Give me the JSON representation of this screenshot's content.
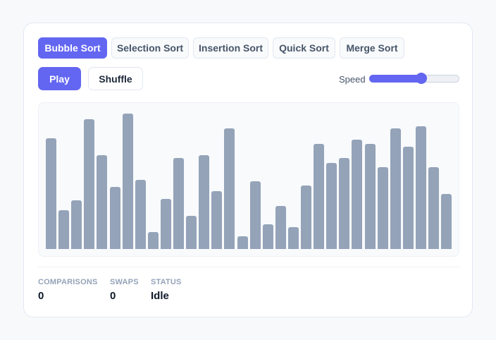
{
  "algorithms": [
    {
      "label": "Bubble Sort",
      "active": true
    },
    {
      "label": "Selection Sort",
      "active": false
    },
    {
      "label": "Insertion Sort",
      "active": false
    },
    {
      "label": "Quick Sort",
      "active": false
    },
    {
      "label": "Merge Sort",
      "active": false
    }
  ],
  "controls": {
    "play_label": "Play",
    "shuffle_label": "Shuffle",
    "speed_label": "Speed",
    "speed_value": 0.58
  },
  "bars": [
    80,
    28,
    35,
    94,
    68,
    45,
    98,
    50,
    12,
    36,
    66,
    24,
    68,
    42,
    87,
    9,
    49,
    18,
    31,
    16,
    46,
    76,
    62,
    66,
    79,
    76,
    59,
    87,
    74,
    89,
    59,
    40
  ],
  "stats": [
    {
      "label": "COMPARISONS",
      "value": "0"
    },
    {
      "label": "SWAPS",
      "value": "0"
    },
    {
      "label": "STATUS",
      "value": "Idle"
    }
  ],
  "colors": {
    "accent": "#6366f1",
    "bar": "#94a3b8"
  }
}
